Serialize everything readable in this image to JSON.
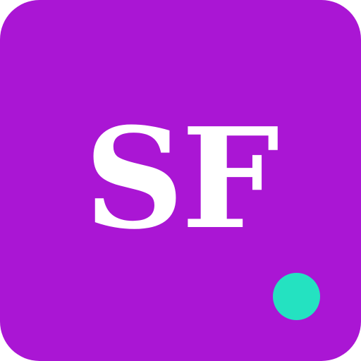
{
  "icon": {
    "monogram": "SF",
    "background_color": "#AA16D4",
    "text_color": "#FFFFFF",
    "status_dot_color": "#24E2C1"
  }
}
